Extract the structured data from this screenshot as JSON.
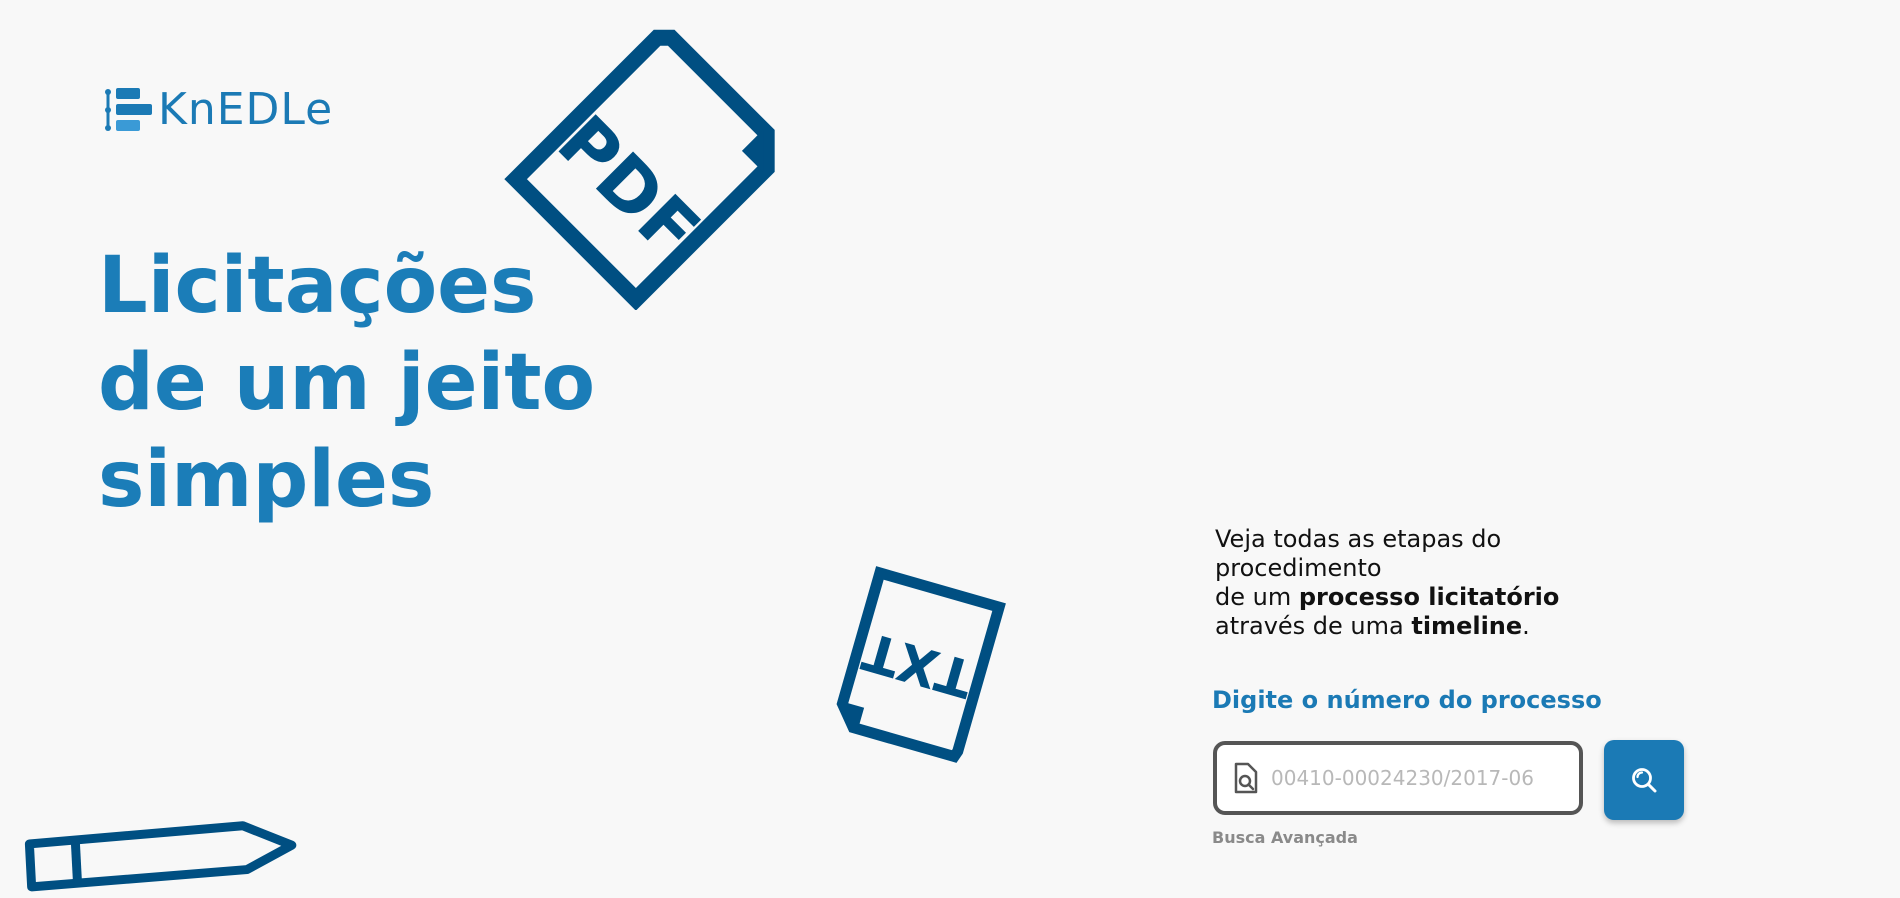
{
  "logo": {
    "text": "KnEDLe"
  },
  "hero": {
    "line1": "Licitações",
    "line2": "de um jeito",
    "line3": "simples"
  },
  "decor": {
    "pdf_label": "PDF",
    "txt_label": "TXT"
  },
  "description": {
    "line1": "Veja todas as etapas do procedimento",
    "line2_prefix": "de um ",
    "line2_bold": "processo licitatório",
    "line3_prefix": "através de uma ",
    "line3_bold": "timeline",
    "line3_suffix": "."
  },
  "search": {
    "label": "Digite o número do processo",
    "placeholder": "00410-00024230/2017-06",
    "field_icon": "document-search-icon",
    "button_icon": "search-icon",
    "advanced_link": "Busca Avançada"
  },
  "colors": {
    "primary": "#1b7ab5",
    "dark_blue": "#004f82",
    "background": "#f8f8f8"
  }
}
